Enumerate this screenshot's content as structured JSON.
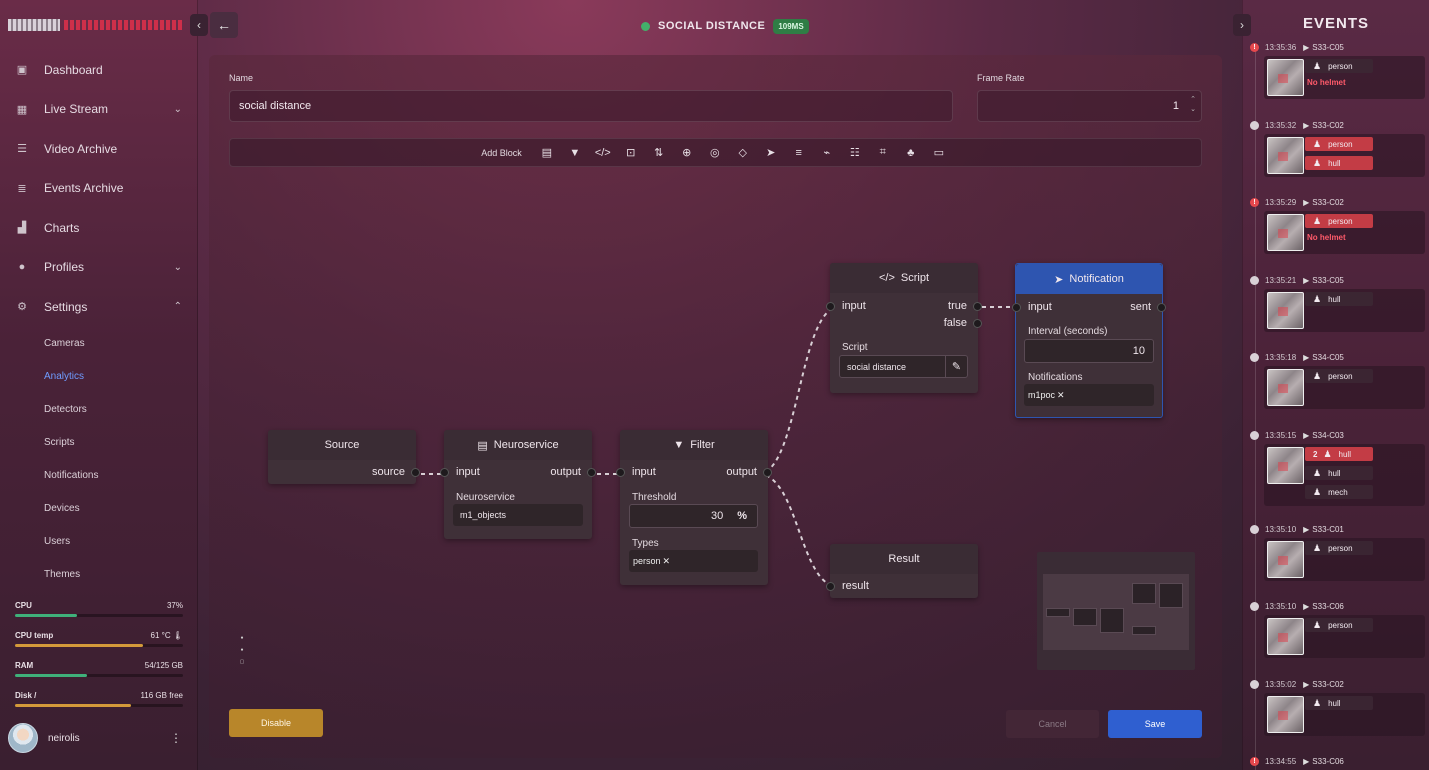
{
  "header": {
    "title": "SOCIAL DISTANCE",
    "latency_badge": "109MS",
    "status_color": "#43b06a"
  },
  "sidebar": {
    "nav": [
      {
        "label": "Dashboard",
        "icon": "dashboard-icon"
      },
      {
        "label": "Live Stream",
        "icon": "grid-icon",
        "expandable": true
      },
      {
        "label": "Video Archive",
        "icon": "archive-icon"
      },
      {
        "label": "Events Archive",
        "icon": "list-icon"
      },
      {
        "label": "Charts",
        "icon": "chart-icon"
      },
      {
        "label": "Profiles",
        "icon": "user-icon",
        "expandable": true
      },
      {
        "label": "Settings",
        "icon": "gear-icon",
        "expanded": true
      }
    ],
    "settings_sub": [
      "Cameras",
      "Analytics",
      "Detectors",
      "Scripts",
      "Notifications",
      "Devices",
      "Users",
      "Themes"
    ],
    "active_sub": "Analytics",
    "metrics": [
      {
        "label": "CPU",
        "value": "37%",
        "level": 0.37,
        "color": "#3fb07a"
      },
      {
        "label": "CPU temp",
        "value": "61 °C",
        "level": 0.76,
        "color": "#d49a3a"
      },
      {
        "label": "RAM",
        "value": "54/125 GB",
        "level": 0.43,
        "color": "#3fb07a"
      },
      {
        "label": "Disk /",
        "value": "116 GB free",
        "level": 0.69,
        "color": "#d49a3a"
      }
    ],
    "user": {
      "name": "neirolis"
    }
  },
  "form": {
    "name_label": "Name",
    "name_value": "social distance",
    "frame_rate_label": "Frame Rate",
    "frame_rate_value": "1",
    "add_block_label": "Add Block"
  },
  "toolbar_icons": [
    "chip-icon",
    "filter-icon",
    "code-icon",
    "frame-icon",
    "sort-icon",
    "zoom-icon",
    "target-icon",
    "tag-icon",
    "send-icon",
    "database-icon",
    "plug-icon",
    "checklist-icon",
    "crop-icon",
    "hierarchy-icon",
    "screen-icon"
  ],
  "nodes": {
    "source": {
      "title": "Source",
      "out": "source"
    },
    "neuro": {
      "title": "Neuroservice",
      "in": "input",
      "out": "output",
      "field_label": "Neuroservice",
      "field_value": "m1_objects"
    },
    "filter": {
      "title": "Filter",
      "in": "input",
      "out": "output",
      "threshold_label": "Threshold",
      "threshold_value": "30",
      "threshold_unit": "%",
      "types_label": "Types",
      "types_tag": "person"
    },
    "script": {
      "title": "Script",
      "in": "input",
      "out_true": "true",
      "out_false": "false",
      "field_label": "Script",
      "field_value": "social distance"
    },
    "notification": {
      "title": "Notification",
      "in": "input",
      "out": "sent",
      "interval_label": "Interval (seconds)",
      "interval_value": "10",
      "notif_label": "Notifications",
      "notif_tag": "m1poc"
    },
    "result": {
      "title": "Result",
      "in": "result"
    }
  },
  "actions": {
    "disable": "Disable",
    "cancel": "Cancel",
    "save": "Save"
  },
  "events": {
    "title": "EVENTS",
    "items": [
      {
        "time": "13:35:36",
        "camera": "S33-C05",
        "alert": true,
        "chips": [
          {
            "label": "person",
            "red": false
          }
        ],
        "warning": "No helmet"
      },
      {
        "time": "13:35:32",
        "camera": "S33-C02",
        "alert": false,
        "chips": [
          {
            "label": "person",
            "red": true
          },
          {
            "label": "hull",
            "red": true
          }
        ],
        "warning": ""
      },
      {
        "time": "13:35:29",
        "camera": "S33-C02",
        "alert": true,
        "chips": [
          {
            "label": "person",
            "red": true
          }
        ],
        "warning": "No helmet"
      },
      {
        "time": "13:35:21",
        "camera": "S33-C05",
        "alert": false,
        "chips": [
          {
            "label": "hull",
            "red": false
          }
        ],
        "warning": ""
      },
      {
        "time": "13:35:18",
        "camera": "S34-C05",
        "alert": false,
        "chips": [
          {
            "label": "person",
            "red": false
          }
        ],
        "warning": ""
      },
      {
        "time": "13:35:15",
        "camera": "S34-C03",
        "alert": false,
        "chips": [
          {
            "label": "hull",
            "red": true,
            "count": "2"
          },
          {
            "label": "hull",
            "red": false
          },
          {
            "label": "mech",
            "red": false
          }
        ],
        "warning": ""
      },
      {
        "time": "13:35:10",
        "camera": "S33-C01",
        "alert": false,
        "chips": [
          {
            "label": "person",
            "red": false
          }
        ],
        "warning": ""
      },
      {
        "time": "13:35:10",
        "camera": "S33-C06",
        "alert": false,
        "chips": [
          {
            "label": "person",
            "red": false
          }
        ],
        "warning": ""
      },
      {
        "time": "13:35:02",
        "camera": "S33-C02",
        "alert": false,
        "chips": [
          {
            "label": "hull",
            "red": false
          }
        ],
        "warning": ""
      },
      {
        "time": "13:34:55",
        "camera": "S33-C06",
        "alert": true,
        "chips": [],
        "warning": ""
      }
    ]
  }
}
